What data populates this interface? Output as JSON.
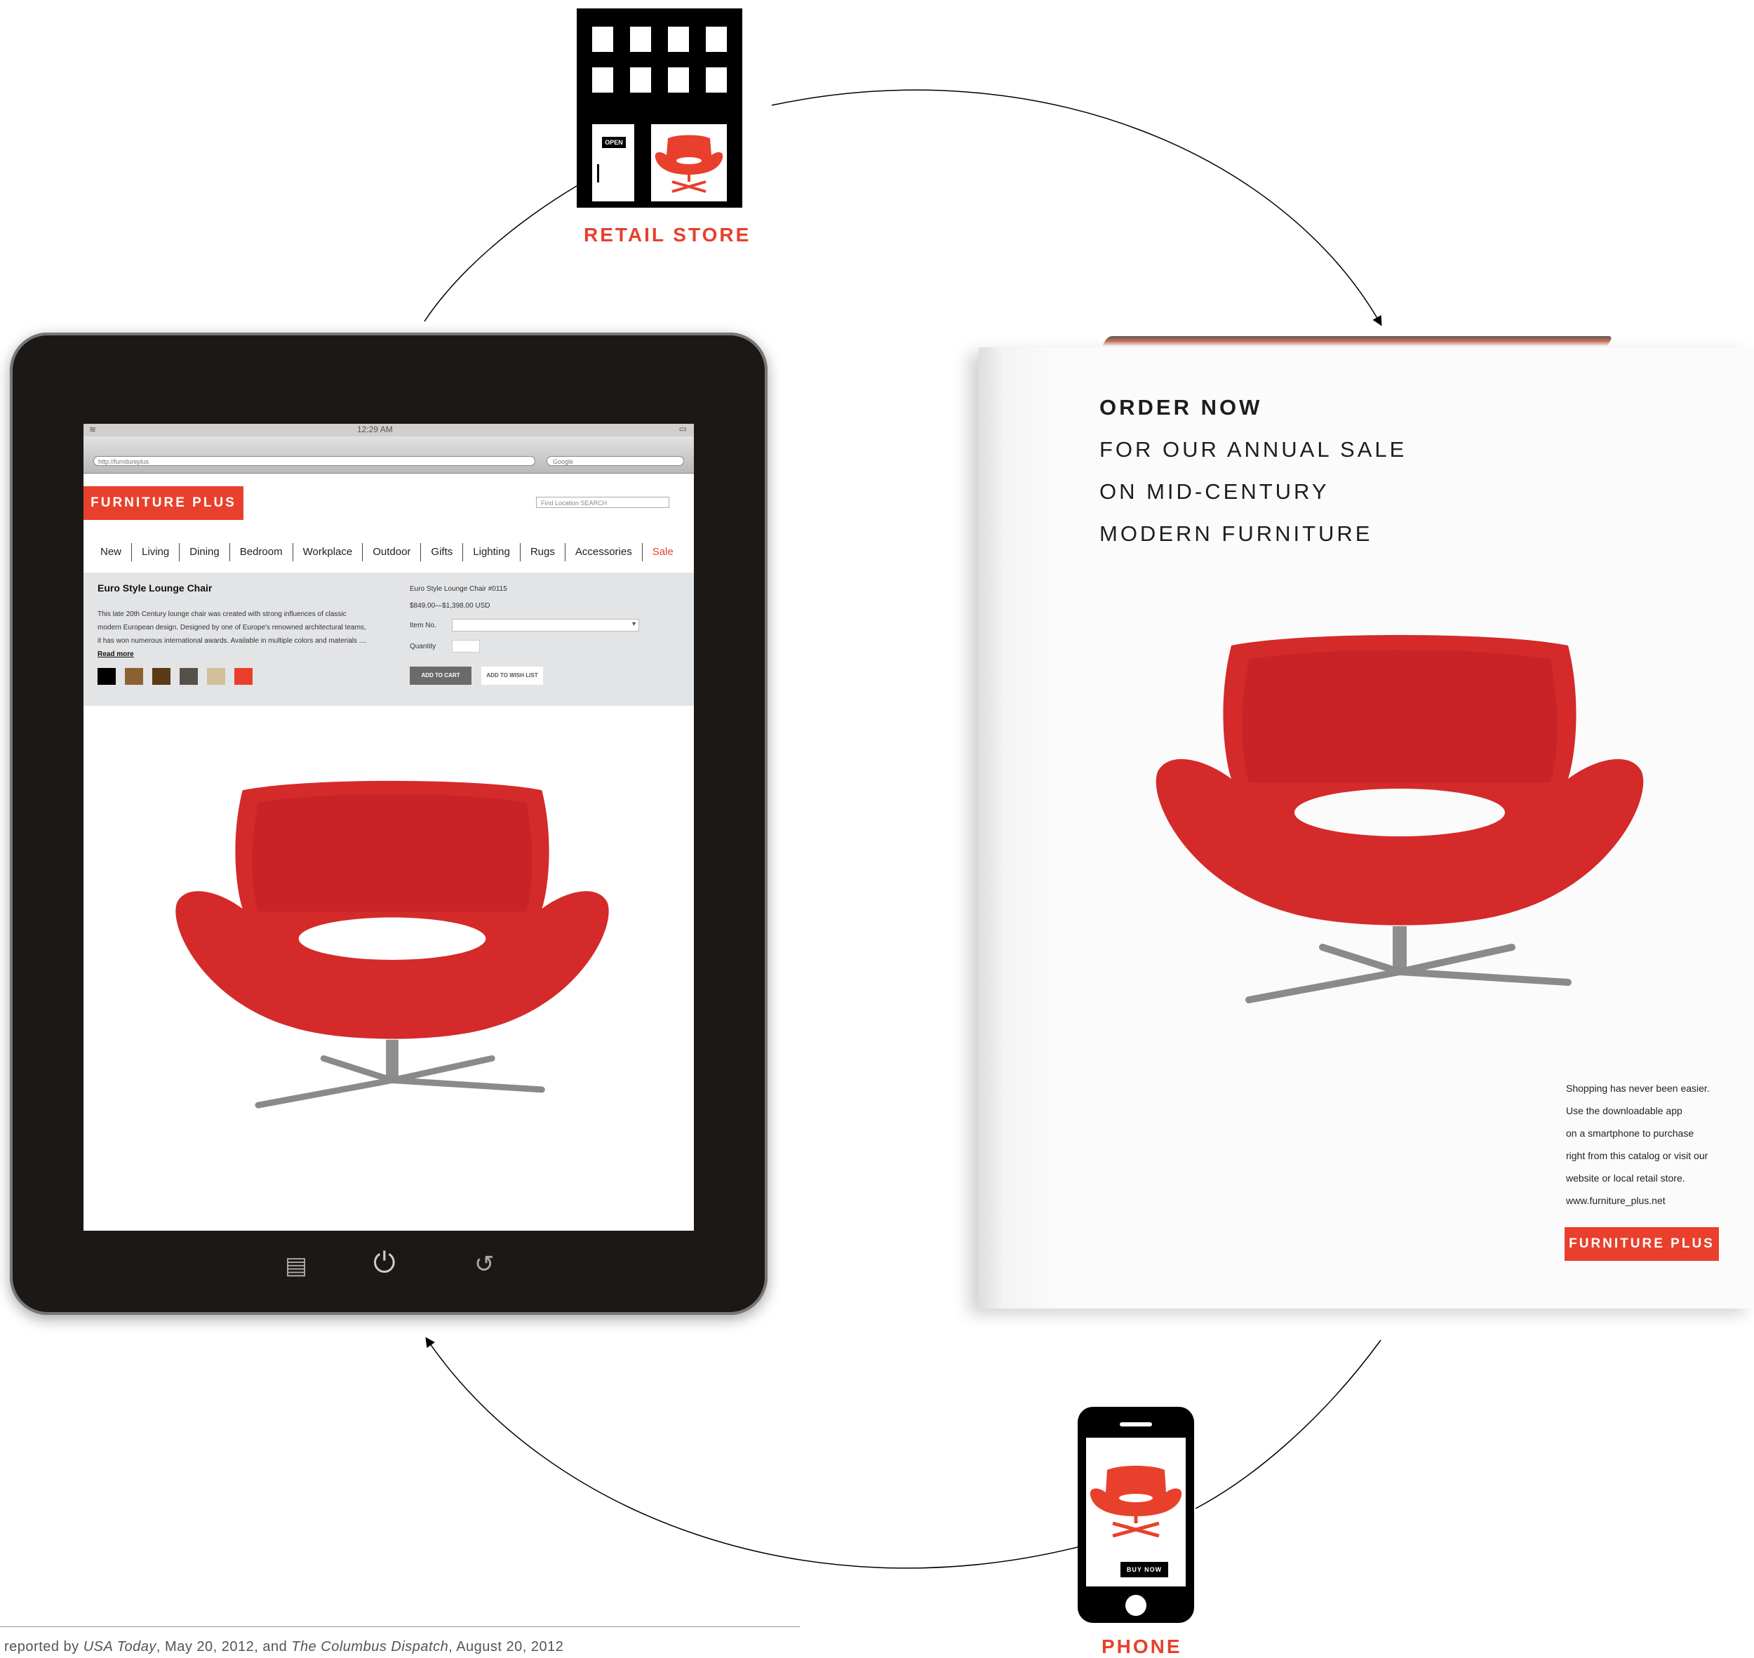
{
  "diagram": {
    "nodes": {
      "retail_store": {
        "label": "RETAIL STORE",
        "icon": "storefront-icon",
        "door_sign": "OPEN"
      },
      "phone": {
        "label": "PHONE",
        "icon": "smartphone-icon",
        "button": "BUY NOW"
      },
      "tablet": {
        "icon": "tablet-icon"
      },
      "catalog": {
        "icon": "catalog-icon"
      }
    },
    "flow": [
      "retail_store",
      "catalog",
      "phone",
      "tablet",
      "retail_store"
    ],
    "accent_color": "#e8402c"
  },
  "tablet": {
    "status_time": "12:29 AM",
    "browser_url": "http://furnitureplus",
    "browser_search": "Google",
    "brand": "FURNITURE PLUS",
    "site_search": "Find Location SEARCH",
    "nav": [
      "New",
      "Living",
      "Dining",
      "Bedroom",
      "Workplace",
      "Outdoor",
      "Gifts",
      "Lighting",
      "Rugs",
      "Accessories",
      "Sale"
    ],
    "product": {
      "title": "Euro Style Lounge Chair",
      "description": "This late 20th Century lounge chair was created with strong influences of classic modern European design. Designed by one of Europe's renowned architectural teams, it has won numerous international awards. Available in multiple colors and materials .... ",
      "read_more": "Read more",
      "code": "Euro Style Lounge Chair #0115",
      "price": "$849.00—$1,398.00 USD",
      "item_label": "Item No.",
      "quantity_label": "Quantity",
      "add_to_cart": "ADD TO CART",
      "add_to_wishlist": "ADD TO WISH LIST",
      "swatches": [
        "#000000",
        "#8a6231",
        "#5b3a15",
        "#55514a",
        "#d1c19b",
        "#e8402c"
      ]
    }
  },
  "catalog": {
    "headline": [
      "ORDER NOW",
      "FOR OUR ANNUAL SALE",
      "ON MID-CENTURY",
      "MODERN FURNITURE"
    ],
    "copy": [
      "Shopping has never been easier.",
      "Use the downloadable app",
      "on a smartphone to purchase",
      "right from this catalog or visit our",
      "website or local retail store.",
      "www.furniture_plus.net"
    ],
    "brand": "FURNITURE PLUS"
  },
  "footer": {
    "prefix": "reported by ",
    "source1": "USA Today",
    "mid": ", May 20, 2012, and ",
    "source2": "The Columbus Dispatch",
    "suffix": ", August 20, 2012"
  }
}
